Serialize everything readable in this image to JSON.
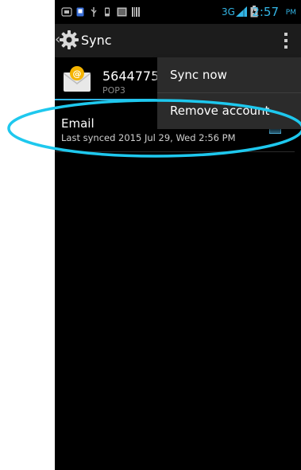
{
  "status_bar": {
    "network": "3G",
    "time": "2:57",
    "ampm": "PM",
    "icons": [
      "sd-card-icon",
      "app-notification-icon",
      "usb-icon",
      "phone-icon",
      "image-icon",
      "barcode-icon",
      "signal-icon",
      "battery-icon"
    ]
  },
  "action_bar": {
    "title": "Sync",
    "up_caret": "‹",
    "icons": [
      "settings-gear-icon",
      "overflow-menu-icon"
    ]
  },
  "account": {
    "id": "564477580",
    "type": "POP3",
    "icon": "email-envelope-icon"
  },
  "sync_items": [
    {
      "label": "Email",
      "last_synced": "Last synced 2015 Jul 29, Wed 2:56 PM",
      "checked": true
    }
  ],
  "menu": {
    "items": [
      {
        "label": "Sync now"
      },
      {
        "label": "Remove account"
      }
    ]
  },
  "colors": {
    "accent": "#33b5e5",
    "annotation": "#1ec8ee",
    "background": "#000000",
    "menu": "#2b2b2b"
  }
}
